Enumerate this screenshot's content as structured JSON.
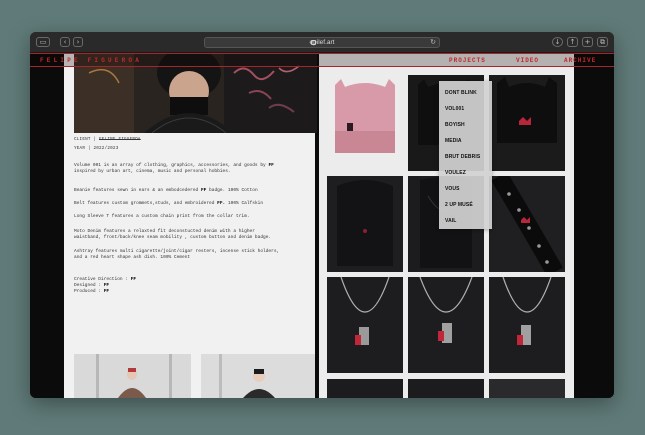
{
  "browser": {
    "url": "epilef.art",
    "sidebar_icon": "sidebar-icon",
    "back_icon": "chevron-left-icon",
    "forward_icon": "chevron-right-icon",
    "reload_icon": "reload-icon",
    "download_icon": "download-icon",
    "share_icon": "share-icon",
    "new_tab_icon": "plus-icon",
    "tabs_icon": "tabs-icon"
  },
  "nav": {
    "brand": "FELIPE FIGUEROA",
    "links": [
      "PROJECTS",
      "VIDEO",
      "ARCHIVE"
    ]
  },
  "dropdown": {
    "items": [
      "DONT BLINK",
      "VOL001",
      "BOYISH",
      "MEDIA",
      "BRUT DEBRIS",
      "VOULEZ",
      "VOUS",
      "2 UP MUSÉ",
      "VAIL"
    ]
  },
  "project": {
    "client_label": "CLIENT",
    "client_value": "FELIPE FIGUEROA",
    "year_label": "YEAR",
    "year_value": "2022/2023",
    "intro_line1": "Volume 001 is an array of clothing, graphics, accessories, and goods by",
    "intro_brand": "FF",
    "intro_line2": "inspired by urban art, cinema, music and personal hobbies.",
    "features": [
      {
        "text": "Beanie features sewn in ears & an embodcedered",
        "brand": "FF",
        "tail": "badge. 100% Cotton"
      },
      {
        "text": "Belt features custom grommets,studs, and embroidered",
        "brand": "FF.",
        "tail": "100% Calfskin"
      },
      {
        "text": "Long Sleeve T features a custom chain print from the collar trim.",
        "brand": "",
        "tail": ""
      }
    ],
    "moto_line1": "Moto Denim features a relaxted fit deconstucted denim with a higher",
    "moto_line2": "waistband, front/back/knee seam mobility , custom button and denim badge.",
    "ashtray_line1": "Ashtray features multi cigarette/joint/cigar resters, incense stick holders,",
    "ashtray_line2": "and a red heart shape ash dish. 100% Cement",
    "credits": [
      {
        "label": "Creative Direction :",
        "value": "FF"
      },
      {
        "label": "Designed :",
        "value": "FF"
      },
      {
        "label": "Produced :",
        "value": "FF"
      }
    ]
  },
  "colors": {
    "accent": "#c0282c",
    "page": "#f1f1f1",
    "window_bg": "#0b0b0b",
    "desktop": "#5f7a78"
  }
}
